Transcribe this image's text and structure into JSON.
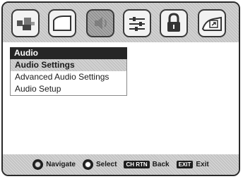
{
  "top_icons": [
    {
      "name": "picture-icon",
      "selected": false
    },
    {
      "name": "screen-shape-icon",
      "selected": false
    },
    {
      "name": "audio-icon",
      "selected": true
    },
    {
      "name": "setup-sliders-icon",
      "selected": false
    },
    {
      "name": "lock-icon",
      "selected": false
    },
    {
      "name": "applications-icon",
      "selected": false
    }
  ],
  "menu": {
    "title": "Audio",
    "items": [
      {
        "label": "Audio Settings",
        "selected": true
      },
      {
        "label": "Advanced Audio Settings",
        "selected": false
      },
      {
        "label": "Audio Setup",
        "selected": false
      }
    ]
  },
  "footer": {
    "navigate": {
      "label": "Navigate",
      "icon": "navigate-ring-icon"
    },
    "select": {
      "label": "Select",
      "icon": "select-button-icon"
    },
    "back": {
      "key": "CH RTN",
      "label": "Back"
    },
    "exit": {
      "key": "EXIT",
      "label": "Exit"
    }
  }
}
